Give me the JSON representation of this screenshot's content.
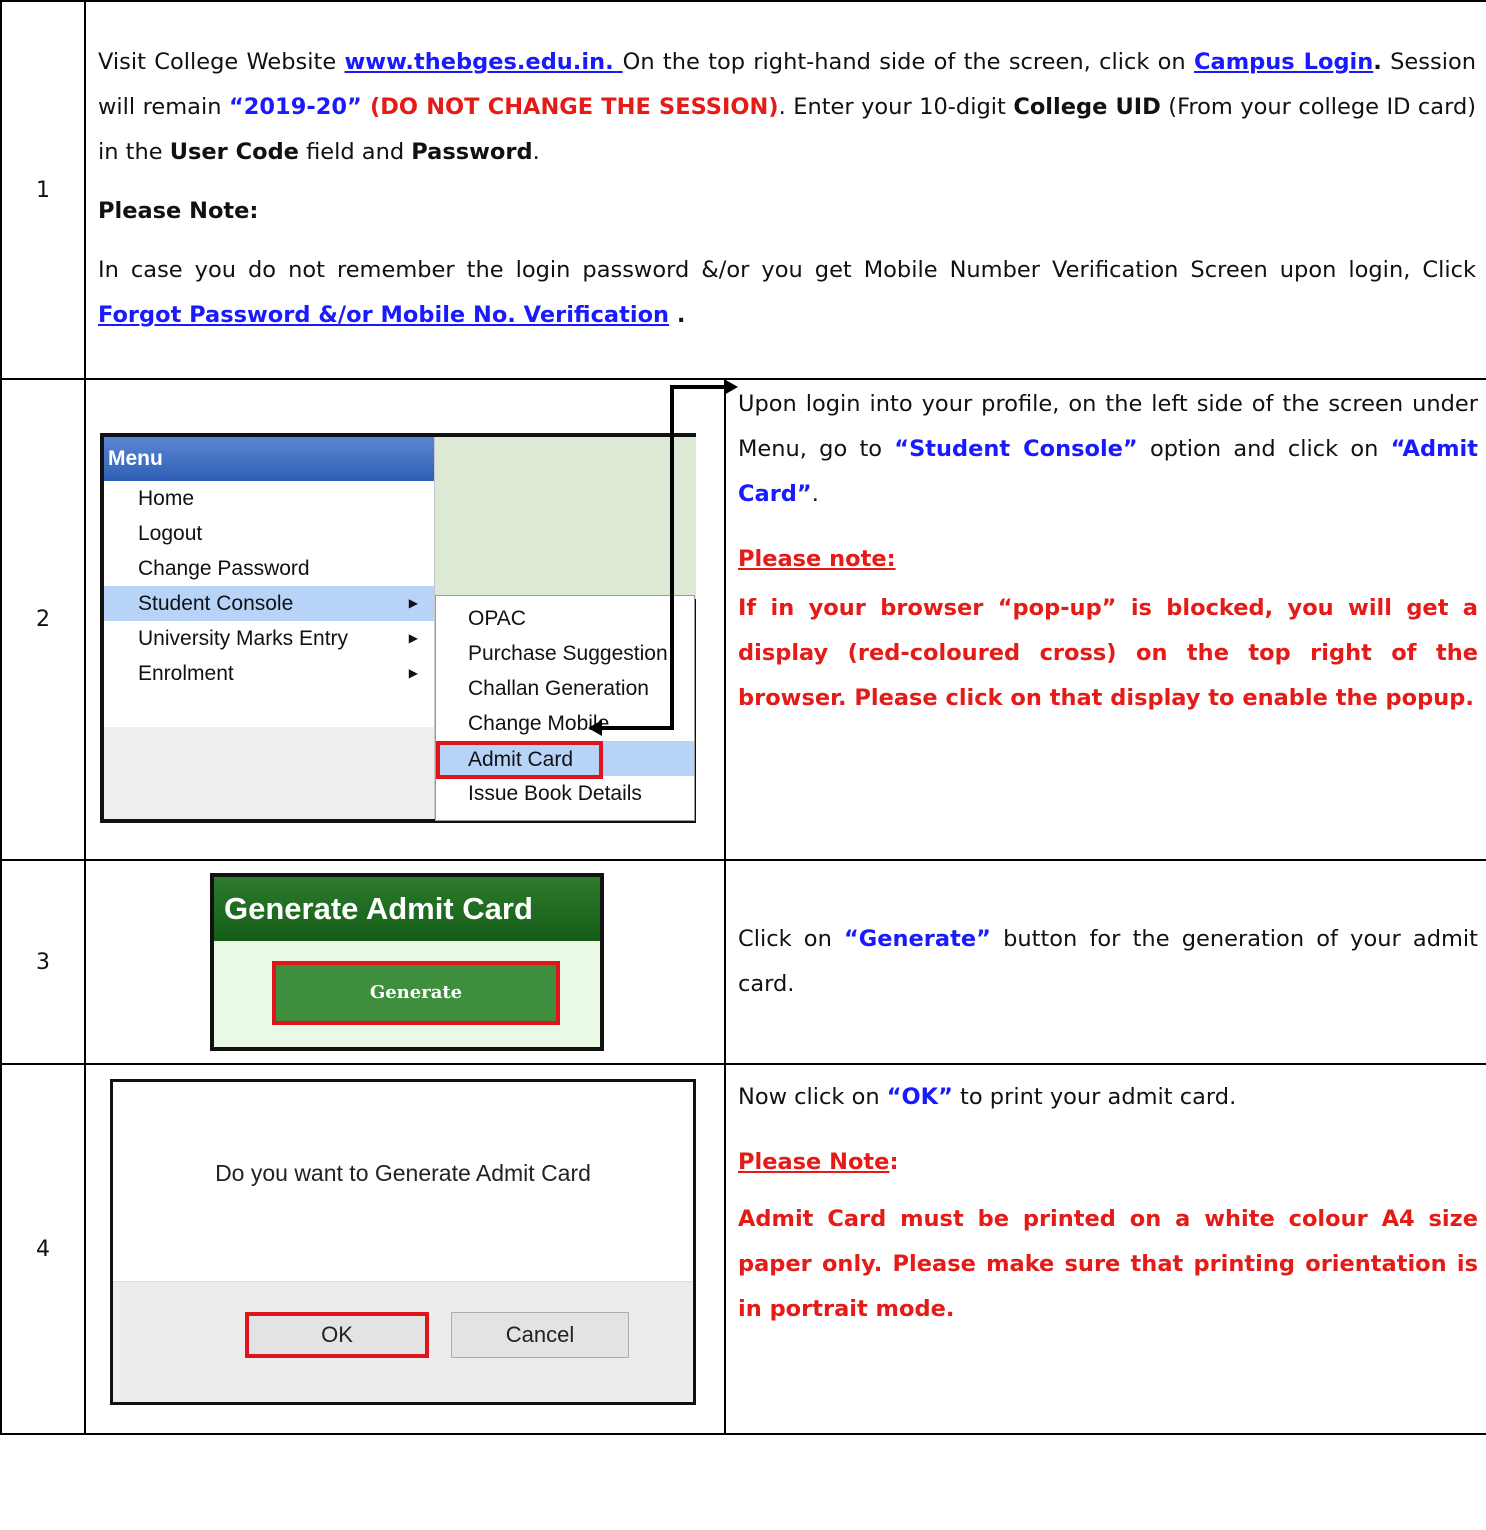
{
  "steps": [
    {
      "number": "1"
    },
    {
      "number": "2"
    },
    {
      "number": "3"
    },
    {
      "number": "4"
    }
  ],
  "step1": {
    "visit": "Visit College Website ",
    "website_link": "www.thebges.edu.in. ",
    "top_right": "On the top right-hand side of the screen, click on ",
    "campus_login_link": "Campus Login",
    "dot1": ".",
    "session_pre": " Session will remain ",
    "session_value": "“2019-20”",
    "session_warning": " (DO NOT CHANGE THE SESSION)",
    "enter_uid": ". Enter your 10-digit ",
    "college_uid": "College UID",
    "from_card": " (From your college ID card) in the ",
    "user_code": "User Code",
    "field_and": " field and ",
    "password": "Password",
    "end_dot": ".",
    "please_note": "Please Note:",
    "note_text": "In case you do not remember the login password &/or you get Mobile Number Verification Screen upon login, Click ",
    "forgot_link": "Forgot Password &/or Mobile No. Verification",
    "note_end": " ."
  },
  "step2": {
    "menu": {
      "header": "Menu",
      "items": [
        "Home",
        "Logout",
        "Change Password",
        "Student Console",
        "University Marks Entry",
        "Enrolment"
      ],
      "submenu": [
        "OPAC",
        "Purchase Suggestion",
        "Challan Generation",
        "Change Mobile",
        "Admit Card",
        "Issue Book Details"
      ]
    },
    "text_a": "Upon login into your profile, on the left side of the screen under Menu, go to ",
    "student_console": "“Student Console”",
    "text_b": " option and click on ",
    "admit_card": "“Admit Card”",
    "text_c": ".",
    "please_note": "Please note:",
    "note_text": "If in your browser “pop-up” is blocked, you will get a display (red-coloured cross) on the top right of the browser. Please click on that display to enable the popup."
  },
  "step3": {
    "panel_title": "Generate Admit Card",
    "button_label": "Generate",
    "text_a": "Click on ",
    "generate": "“Generate”",
    "text_b": " button for the generation of your admit card."
  },
  "step4": {
    "dialog_question": "Do you want to Generate Admit Card",
    "ok_label": "OK",
    "cancel_label": "Cancel",
    "text_a": "Now click on ",
    "ok_quote": "“OK”",
    "text_b": " to print your admit card.",
    "please_note": "Please Note",
    "colon": ":",
    "note_text": "Admit Card must be printed on a white colour A4 size paper only. Please make sure that printing orientation is in portrait mode."
  },
  "colors": {
    "highlight_blue": "#1a1aff",
    "warning_red": "#e41b17",
    "menu_header": "#2f5fb4",
    "panel_green": "#155d18"
  }
}
